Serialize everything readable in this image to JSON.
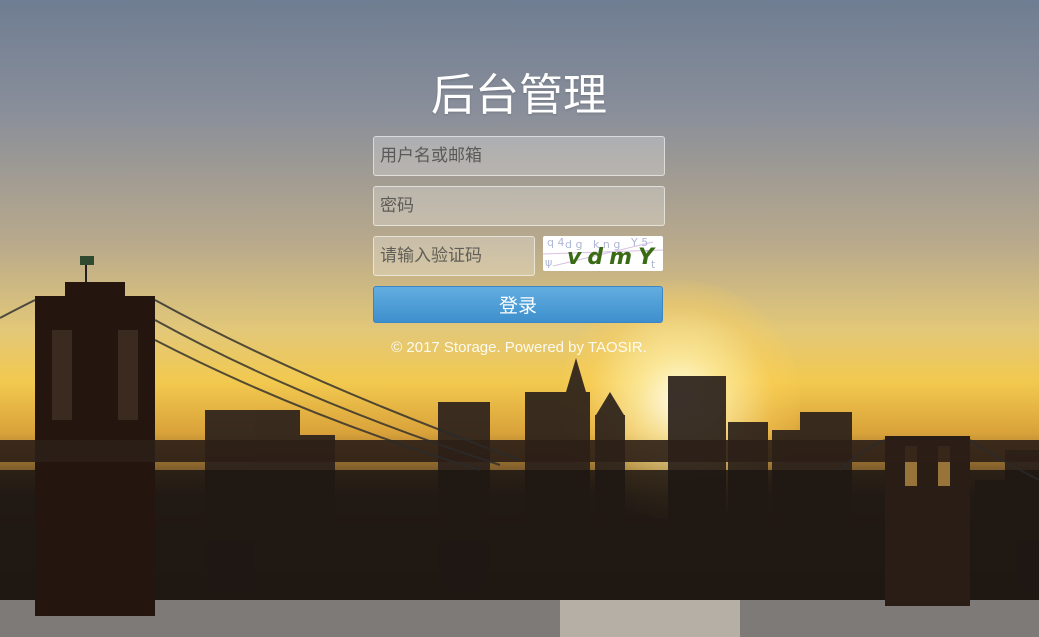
{
  "page": {
    "title": "后台管理"
  },
  "form": {
    "username_placeholder": "用户名或邮箱",
    "password_placeholder": "密码",
    "captcha_placeholder": "请输入验证码",
    "captcha_text": "vdmY",
    "login_label": "登录"
  },
  "footer": {
    "text": "© 2017 Storage. Powered by TAOSIR."
  },
  "colors": {
    "button": "#4a9bd6",
    "title": "#ffffff",
    "captcha_text": "#3a6b14"
  }
}
